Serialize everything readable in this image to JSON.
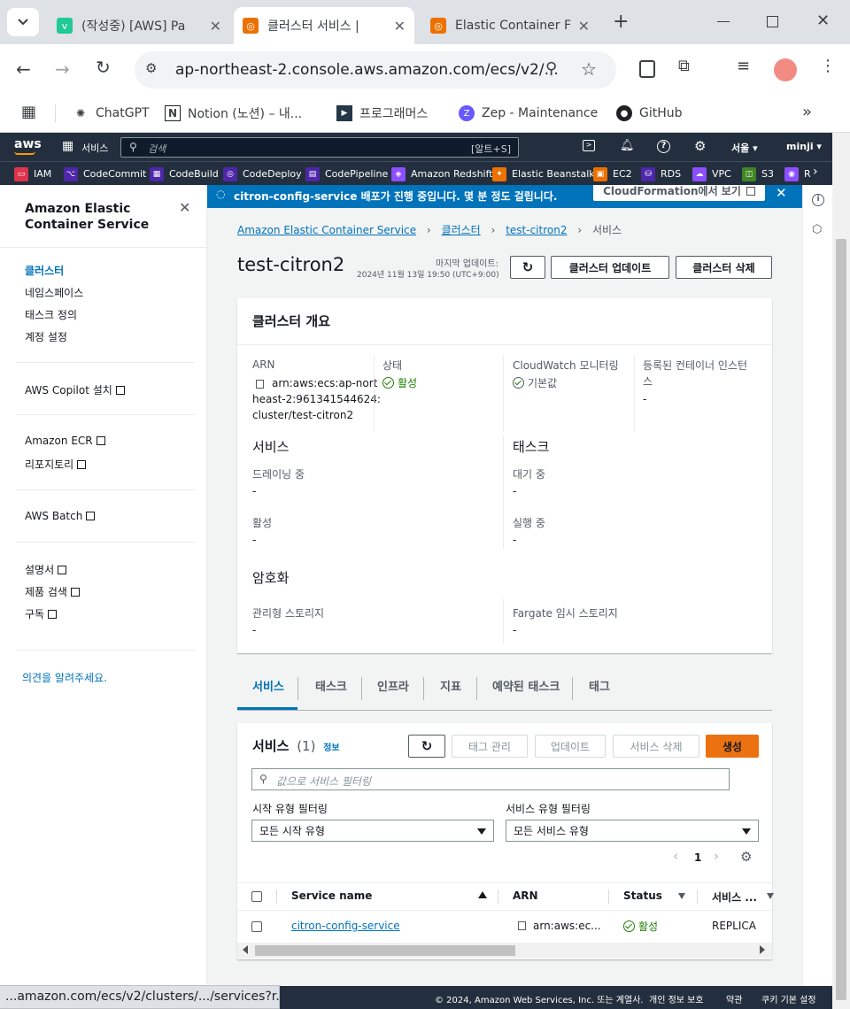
{
  "browser": {
    "tabs": [
      {
        "title": "(작성중) [AWS] Pa",
        "favicon": "v"
      },
      {
        "title": "클러스터 서비스 |",
        "favicon": "ecs"
      },
      {
        "title": "Elastic Container F",
        "favicon": "ecs"
      }
    ],
    "url": "ap-northeast-2.console.aws.amazon.com/ecs/v2/...",
    "bookmarks": [
      "ChatGPT",
      "Notion (노션) – 내...",
      "프로그래머스",
      "Zep - Maintenance",
      "GitHub"
    ],
    "status_url": "...amazon.com/ecs/v2/clusters/.../services?r..."
  },
  "aws_header": {
    "logo": "aws",
    "services_label": "서비스",
    "search_placeholder": "검색",
    "search_shortcut": "[알트+S]",
    "region": "서울 ▾",
    "user": "minji ▾",
    "favorites": [
      {
        "label": "IAM",
        "color": "#dd344c"
      },
      {
        "label": "CodeCommit",
        "color": "#4d27a8"
      },
      {
        "label": "CodeBuild",
        "color": "#4d27a8"
      },
      {
        "label": "CodeDeploy",
        "color": "#4d27a8"
      },
      {
        "label": "CodePipeline",
        "color": "#4d27a8"
      },
      {
        "label": "Amazon Redshift",
        "color": "#8c4fff"
      },
      {
        "label": "Elastic Beanstalk",
        "color": "#ed7100"
      },
      {
        "label": "EC2",
        "color": "#ed7100"
      },
      {
        "label": "RDS",
        "color": "#4d27a8"
      },
      {
        "label": "VPC",
        "color": "#8c4fff"
      },
      {
        "label": "S3",
        "color": "#3f8624"
      },
      {
        "label": "R",
        "color": "#8c4fff"
      }
    ]
  },
  "sidenav": {
    "title": "Amazon Elastic Container Service",
    "items": [
      "클러스터",
      "네임스페이스",
      "태스크 정의",
      "계정 설정"
    ],
    "copilot": "AWS Copilot 설치",
    "ecr": "Amazon ECR",
    "repos": "리포지토리",
    "batch": "AWS Batch",
    "docs": "설명서",
    "search": "제품 검색",
    "subscribe": "구독",
    "feedback": "의견을 알려주세요."
  },
  "flash": {
    "message": "citron-config-service 배포가 진행 중입니다. 몇 분 정도 걸립니다.",
    "button": "CloudFormation에서 보기"
  },
  "breadcrumb": [
    "Amazon Elastic Container Service",
    "클러스터",
    "test-citron2",
    "서비스"
  ],
  "page": {
    "title": "test-citron2",
    "last_updated_label": "마지막 업데이트:",
    "last_updated_value": "2024년 11월 13일 19:50 (UTC+9:00)",
    "update_button": "클러스터 업데이트",
    "delete_button": "클러스터 삭제"
  },
  "overview": {
    "title": "클러스터 개요",
    "arn_label": "ARN",
    "arn_lines": [
      "arn:aws:ecs:ap-nort",
      "heast-2:961341544624:",
      "cluster/test-citron2"
    ],
    "status_label": "상태",
    "status_value": "활성",
    "cloudwatch_label": "CloudWatch 모니터링",
    "cloudwatch_value": "기본값",
    "instances_label_1": "등록된 컨테이너 인스턴",
    "instances_label_2": "스",
    "instances_value": "-",
    "services_title": "서비스",
    "draining_label": "드레이닝 중",
    "draining_value": "-",
    "active_label": "활성",
    "active_value": "-",
    "tasks_title": "태스크",
    "pending_label": "대기 중",
    "pending_value": "-",
    "running_label": "실행 중",
    "running_value": "-",
    "encryption_title": "암호화",
    "managed_storage_label": "관리형 스토리지",
    "managed_storage_value": "-",
    "fargate_storage_label": "Fargate 임시 스토리지",
    "fargate_storage_value": "-"
  },
  "tabs": [
    "서비스",
    "태스크",
    "인프라",
    "지표",
    "예약된 태스크",
    "태그"
  ],
  "services_panel": {
    "title": "서비스",
    "count": "(1)",
    "info": "정보",
    "manage_tags": "태그 관리",
    "update": "업데이트",
    "delete": "서비스 삭제",
    "create": "생성",
    "filter_placeholder": "값으로 서비스 필터링",
    "launch_filter_label": "시작 유형 필터링",
    "launch_filter_value": "모든 시작 유형",
    "service_filter_label": "서비스 유형 필터링",
    "service_filter_value": "모든 서비스 유형",
    "page": "1",
    "columns": [
      "Service name",
      "ARN",
      "Status",
      "서비스 ..."
    ],
    "rows": [
      {
        "name": "citron-config-service",
        "arn": "arn:aws:ec...",
        "status": "활성",
        "type": "REPLICA"
      }
    ]
  },
  "footer": {
    "copyright": "© 2024, Amazon Web Services, Inc. 또는 계열사.",
    "privacy": "개인 정보 보호",
    "terms": "약관",
    "cookies": "쿠키 기본 설정"
  },
  "colors": {
    "accent": "#0073bb",
    "primary_button": "#ec7211",
    "success": "#1d8102",
    "aws_nav": "#232f3e"
  }
}
